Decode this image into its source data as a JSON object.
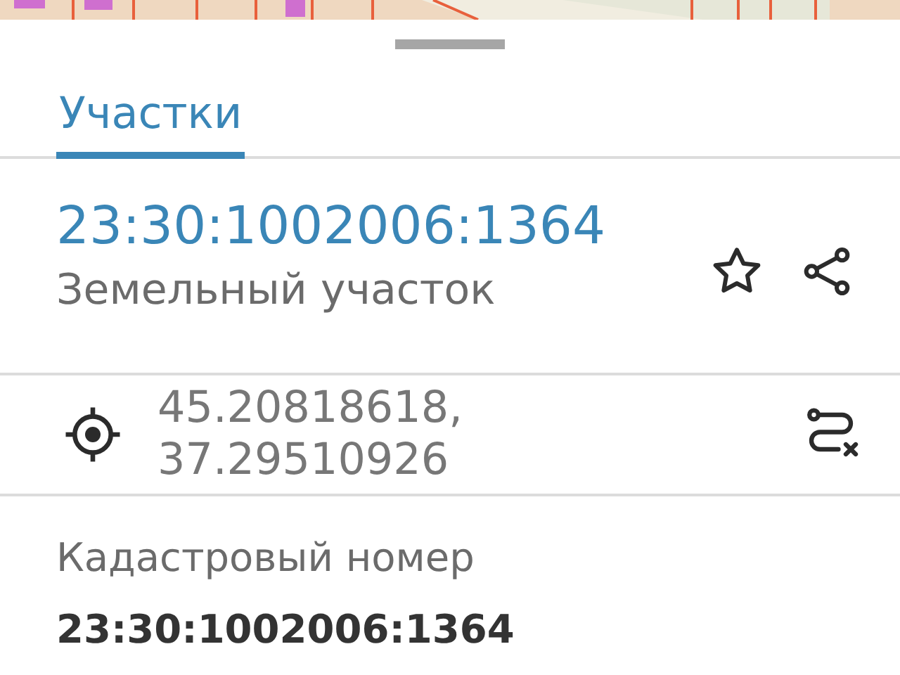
{
  "tabs": [
    {
      "label": "Участки",
      "selected": true
    }
  ],
  "parcel": {
    "number": "23:30:1002006:1364",
    "type": "Земельный участок"
  },
  "coordinates": {
    "lines": [
      "45.20818618,",
      "37.29510926"
    ]
  },
  "details": [
    {
      "label": "Кадастровый номер",
      "value": "23:30:1002006:1364"
    }
  ]
}
